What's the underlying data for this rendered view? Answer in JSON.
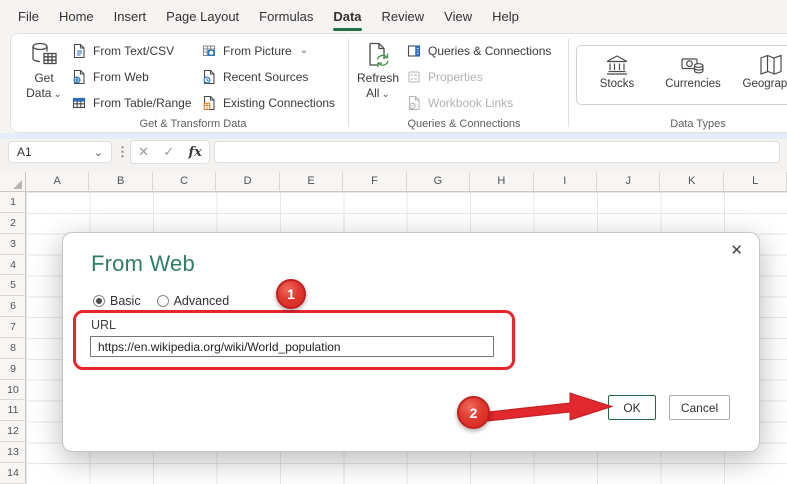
{
  "ribbon": {
    "tabs": [
      {
        "label": "File"
      },
      {
        "label": "Home"
      },
      {
        "label": "Insert"
      },
      {
        "label": "Page Layout"
      },
      {
        "label": "Formulas"
      },
      {
        "label": "Data",
        "active": true
      },
      {
        "label": "Review"
      },
      {
        "label": "View"
      },
      {
        "label": "Help"
      }
    ],
    "get_transform": {
      "group_label": "Get & Transform Data",
      "get_data_label_1": "Get",
      "get_data_label_2": "Data",
      "items": {
        "from_text_csv": "From Text/CSV",
        "from_web": "From Web",
        "from_table_range": "From Table/Range",
        "from_picture": "From Picture",
        "recent_sources": "Recent Sources",
        "existing_connections": "Existing Connections"
      }
    },
    "queries_connections": {
      "group_label": "Queries & Connections",
      "refresh_label_1": "Refresh",
      "refresh_label_2": "All",
      "items": {
        "queries_connections": "Queries & Connections",
        "properties": "Properties",
        "workbook_links": "Workbook Links"
      }
    },
    "data_types": {
      "group_label": "Data Types",
      "items": {
        "stocks": "Stocks",
        "currencies": "Currencies",
        "geography": "Geography"
      }
    }
  },
  "formula_bar": {
    "name_box_value": "A1",
    "fx_label": "fx"
  },
  "grid": {
    "columns": [
      "A",
      "B",
      "C",
      "D",
      "E",
      "F",
      "G",
      "H",
      "I",
      "J",
      "K",
      "L"
    ],
    "rows": [
      "1",
      "2",
      "3",
      "4",
      "5",
      "6",
      "7",
      "8",
      "9",
      "10",
      "11",
      "12",
      "13",
      "14"
    ]
  },
  "dialog": {
    "title": "From Web",
    "basic_label": "Basic",
    "advanced_label": "Advanced",
    "url_label": "URL",
    "url_value": "https://en.wikipedia.org/wiki/World_population",
    "ok_label": "OK",
    "cancel_label": "Cancel"
  },
  "annotations": {
    "step_1": "1",
    "step_2": "2"
  },
  "icons": {
    "chevron_down": "⌄",
    "close": "✕",
    "cancel": "✕",
    "confirm": "✓",
    "separator_dots": "⋮"
  },
  "colors": {
    "accent_green": "#1e7145",
    "dialog_title_teal": "#2f7d68",
    "annotation_red": "#e5262d",
    "ok_border_green": "#1e6b43"
  }
}
